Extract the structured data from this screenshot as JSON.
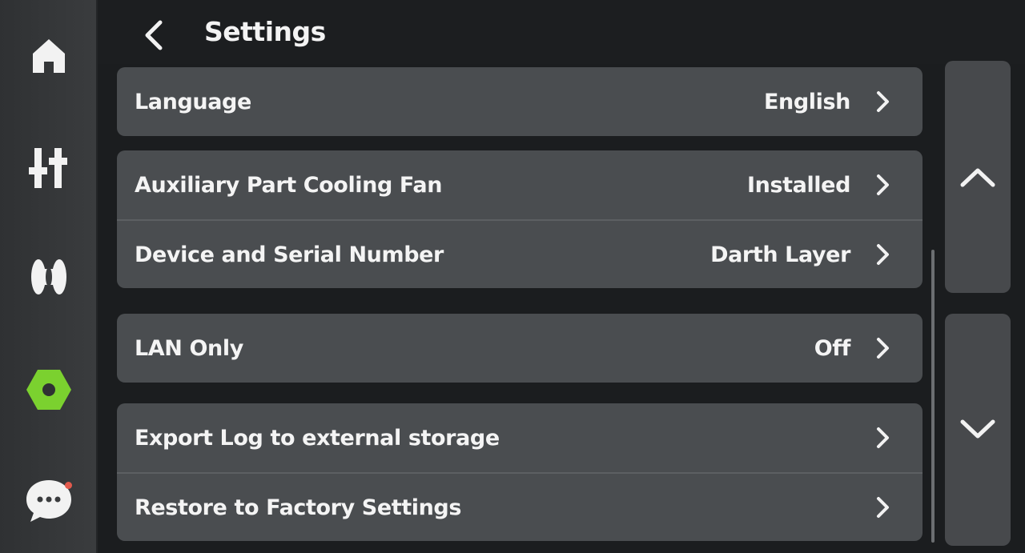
{
  "sidebar": {
    "items": [
      {
        "name": "home",
        "icon": "home-icon",
        "active": false
      },
      {
        "name": "controls",
        "icon": "sliders-icon",
        "active": false
      },
      {
        "name": "filament",
        "icon": "filament-icon",
        "active": false
      },
      {
        "name": "settings",
        "icon": "hex-settings-icon",
        "active": true
      },
      {
        "name": "messages",
        "icon": "chat-icon",
        "active": false,
        "notification": true
      }
    ],
    "active_color": "#7bd12f"
  },
  "header": {
    "title": "Settings",
    "back_icon": "chevron-left-icon"
  },
  "groups": [
    {
      "rows": [
        {
          "label": "Language",
          "value": "English"
        }
      ]
    },
    {
      "rows": [
        {
          "label": "Auxiliary Part Cooling Fan",
          "value": "Installed"
        },
        {
          "label": "Device and Serial Number",
          "value": "Darth Layer"
        }
      ]
    },
    {
      "rows": [
        {
          "label": "LAN Only",
          "value": "Off"
        }
      ]
    },
    {
      "rows": [
        {
          "label": "Export Log to external storage",
          "value": ""
        },
        {
          "label": "Restore to Factory Settings",
          "value": ""
        }
      ]
    }
  ],
  "scroll": {
    "up_icon": "chevron-up-icon",
    "down_icon": "chevron-down-icon"
  }
}
